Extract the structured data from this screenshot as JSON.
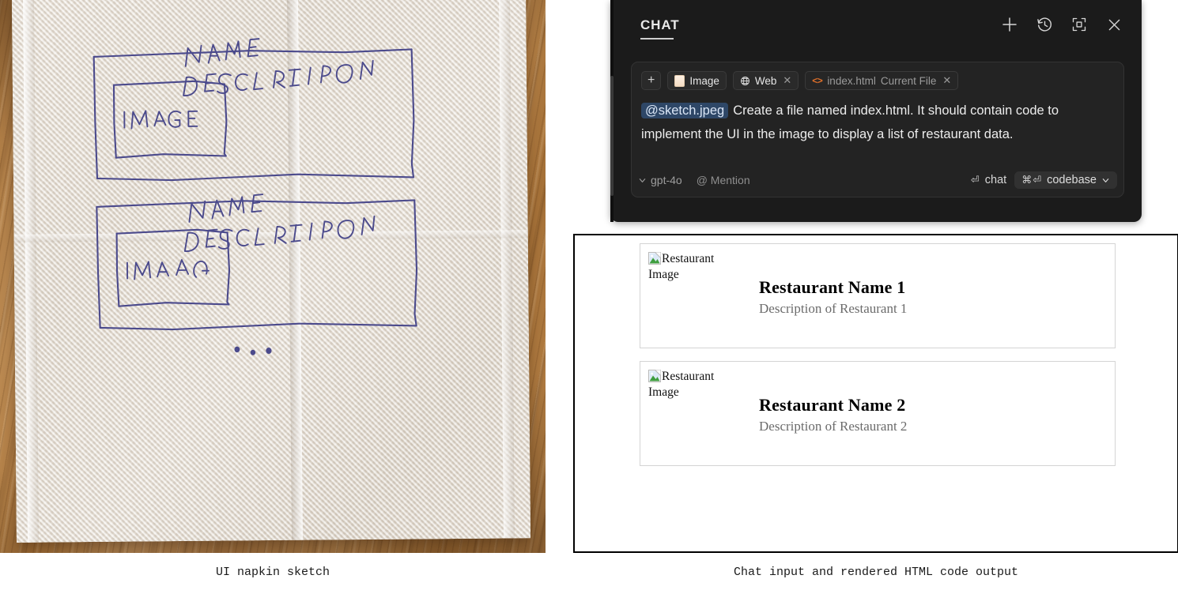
{
  "left_pane": {
    "caption": "UI napkin sketch",
    "sketch": {
      "rows": [
        {
          "image_label": "IMAGE",
          "name_label": "NAME",
          "description_label": "DESCRIPTION"
        },
        {
          "image_label": "IMAGA",
          "name_label": "NAME",
          "description_label": "DESCRIPTION"
        }
      ],
      "ellipsis": "• • •",
      "ink_color": "#4b4a8c"
    }
  },
  "chat": {
    "title": "CHAT",
    "header_icons": [
      {
        "name": "new-chat-icon",
        "glyph": "plus"
      },
      {
        "name": "history-icon",
        "glyph": "clock-back"
      },
      {
        "name": "expand-icon",
        "glyph": "maximize"
      },
      {
        "name": "close-icon",
        "glyph": "close"
      }
    ],
    "context_chips": {
      "add_label": "+",
      "image_label": "Image",
      "web_label": "Web",
      "web_close": "✕",
      "file_name": "index.html",
      "file_sub": "Current File",
      "file_close": "✕"
    },
    "prompt": {
      "mention": "@sketch.jpeg",
      "text": "Create a file named index.html. It should contain code to implement the UI in the image to display a list of restaurant data."
    },
    "footer": {
      "model": "gpt-4o",
      "mention_button": "@ Mention",
      "send_mode": "chat",
      "send_mode_key": "⏎",
      "codebase_label": "codebase",
      "codebase_key": "⌘⏎"
    }
  },
  "render_output": {
    "caption": "Chat input and rendered HTML code output",
    "cards": [
      {
        "image_alt": "Restaurant Image",
        "name": "Restaurant Name 1",
        "description": "Description of Restaurant 1"
      },
      {
        "image_alt": "Restaurant Image",
        "name": "Restaurant Name 2",
        "description": "Description of Restaurant 2"
      }
    ]
  },
  "colors": {
    "chat_bg": "#1b1b1b",
    "composer_bg": "#232323",
    "mention_bg": "#2e4767",
    "accent_orange": "#e0702a",
    "ink": "#4b4a8c"
  }
}
